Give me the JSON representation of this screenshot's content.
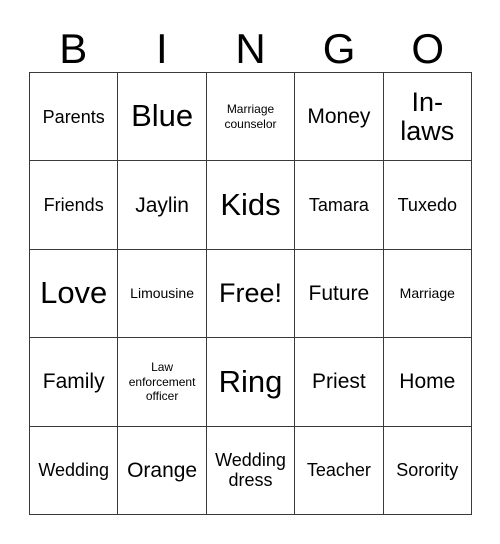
{
  "card": {
    "type": "bingo-card",
    "header_letters": [
      "B",
      "I",
      "N",
      "G",
      "O"
    ],
    "grid_size": 5,
    "colors": {
      "background": "#ffffff",
      "cell_background": "#ffffff",
      "border": "#3a3a3a",
      "text": "#000000"
    },
    "cells": [
      {
        "text": "Parents",
        "size": "sm"
      },
      {
        "text": "Blue",
        "size": "xl"
      },
      {
        "text": "Marriage counselor",
        "size": "xxs"
      },
      {
        "text": "Money",
        "size": "md"
      },
      {
        "text": "In-laws",
        "size": "lg"
      },
      {
        "text": "Friends",
        "size": "sm"
      },
      {
        "text": "Jaylin",
        "size": "md"
      },
      {
        "text": "Kids",
        "size": "xl"
      },
      {
        "text": "Tamara",
        "size": "sm"
      },
      {
        "text": "Tuxedo",
        "size": "sm"
      },
      {
        "text": "Love",
        "size": "xl"
      },
      {
        "text": "Limousine",
        "size": "xs"
      },
      {
        "text": "Free!",
        "size": "lg"
      },
      {
        "text": "Future",
        "size": "md"
      },
      {
        "text": "Marriage",
        "size": "xs"
      },
      {
        "text": "Family",
        "size": "md"
      },
      {
        "text": "Law enforcement officer",
        "size": "xxs"
      },
      {
        "text": "Ring",
        "size": "xl"
      },
      {
        "text": "Priest",
        "size": "md"
      },
      {
        "text": "Home",
        "size": "md"
      },
      {
        "text": "Wedding",
        "size": "sm"
      },
      {
        "text": "Orange",
        "size": "md"
      },
      {
        "text": "Wedding dress",
        "size": "sm"
      },
      {
        "text": "Teacher",
        "size": "sm"
      },
      {
        "text": "Sorority",
        "size": "sm"
      }
    ]
  }
}
